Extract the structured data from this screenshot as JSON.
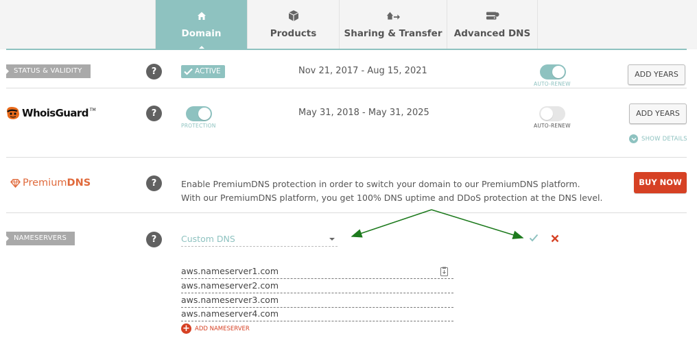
{
  "tabs": [
    {
      "label": "Domain",
      "icon": "home-icon",
      "active": true
    },
    {
      "label": "Products",
      "icon": "box-icon",
      "active": false
    },
    {
      "label": "Sharing & Transfer",
      "icon": "transfer-icon",
      "active": false
    },
    {
      "label": "Advanced DNS",
      "icon": "server-icon",
      "active": false
    }
  ],
  "status": {
    "section_label": "STATUS & VALIDITY",
    "badge": "ACTIVE",
    "dates": "Nov 21, 2017 - Aug 15, 2021",
    "auto_renew_caption": "AUTO-RENEW",
    "auto_renew_on": true,
    "add_years_label": "ADD YEARS"
  },
  "whoisguard": {
    "logo_text": "WhoisGuard",
    "logo_tm": "TM",
    "protection_caption": "PROTECTION",
    "protection_on": true,
    "dates": "May 31, 2018 - May 31, 2025",
    "auto_renew_caption": "AUTO-RENEW",
    "auto_renew_on": false,
    "add_years_label": "ADD YEARS",
    "show_details_label": "SHOW DETAILS"
  },
  "premium_dns": {
    "logo_part1": "Premium",
    "logo_part2": "DNS",
    "description_line1": "Enable PremiumDNS protection in order to switch your domain to our PremiumDNS platform.",
    "description_line2": "With our PremiumDNS platform, you get 100% DNS uptime and DDoS protection at the DNS level.",
    "buy_label": "BUY NOW"
  },
  "nameservers": {
    "section_label": "NAMESERVERS",
    "selected_option": "Custom DNS",
    "servers": [
      "aws.nameserver1.com",
      "aws.nameserver2.com",
      "aws.nameserver3.com",
      "aws.nameserver4.com"
    ],
    "add_label": "ADD NAMESERVER"
  },
  "help_label": "?",
  "colors": {
    "accent": "#8ec2c0",
    "danger": "#d64124",
    "annotation_arrow": "#1d7a1d"
  }
}
